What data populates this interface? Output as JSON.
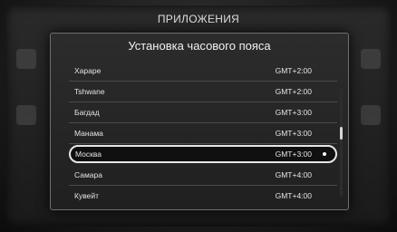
{
  "header": {
    "title": "ПРИЛОЖЕНИЯ"
  },
  "dialog": {
    "title": "Установка часового пояса",
    "rows": [
      {
        "name": "Хараре",
        "gmt": "GMT+2:00"
      },
      {
        "name": "Tshwane",
        "gmt": "GMT+2:00"
      },
      {
        "name": "Багдад",
        "gmt": "GMT+3:00"
      },
      {
        "name": "Манама",
        "gmt": "GMT+3:00"
      },
      {
        "name": "Москва",
        "gmt": "GMT+3:00",
        "selected": true
      },
      {
        "name": "Самара",
        "gmt": "GMT+4:00"
      },
      {
        "name": "Кувейт",
        "gmt": "GMT+4:00"
      }
    ]
  },
  "colors": {
    "background": "#141414",
    "accent": "#e6e6e6"
  },
  "scroll": {
    "position": 0.36
  }
}
